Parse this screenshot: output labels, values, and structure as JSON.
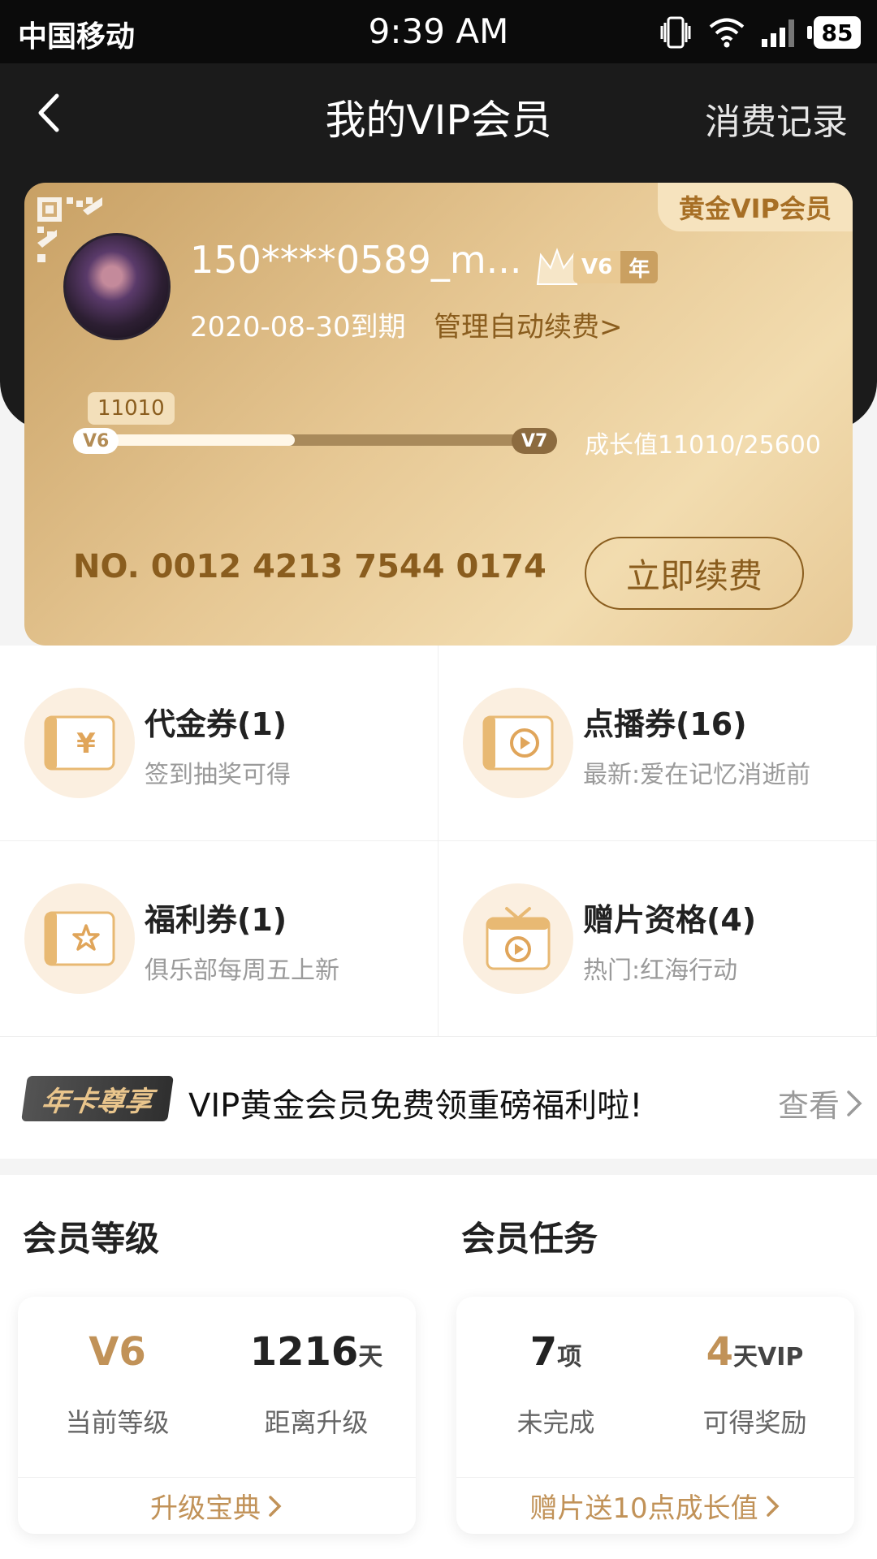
{
  "status_bar": {
    "carrier": "中国移动",
    "time": "9:39 AM",
    "battery": "85"
  },
  "nav": {
    "title": "我的VIP会员",
    "right_link": "消费记录"
  },
  "vip_card": {
    "tag": "黄金VIP会员",
    "username": "150****0589_m...",
    "level_badge": "V6",
    "level_badge_year": "年",
    "expire": "2020-08-30到期",
    "manage_renew": "管理自动续费>",
    "growth_value_bubble": "11010",
    "current_level": "V6",
    "next_level": "V7",
    "growth_text": "成长值11010/25600",
    "growth_progress": 0.43,
    "card_number": "NO. 0012 4213 7544 0174",
    "renew_button": "立即续费"
  },
  "coupons": [
    {
      "title": "代金券(1)",
      "subtitle": "签到抽奖可得",
      "icon": "yuan-ticket-icon"
    },
    {
      "title": "点播券(16)",
      "subtitle": "最新:爱在记忆消逝前",
      "icon": "play-ticket-icon"
    },
    {
      "title": "福利券(1)",
      "subtitle": "俱乐部每周五上新",
      "icon": "star-ticket-icon"
    },
    {
      "title": "赠片资格(4)",
      "subtitle": "热门:红海行动",
      "icon": "gift-video-icon"
    }
  ],
  "promo": {
    "badge": "年卡尊享",
    "text": "VIP黄金会员免费领重磅福利啦!",
    "link": "查看"
  },
  "member_level": {
    "title": "会员等级",
    "stat1_value": "V6",
    "stat1_label": "当前等级",
    "stat2_value": "1216",
    "stat2_unit": "天",
    "stat2_label": "距离升级",
    "link": "升级宝典"
  },
  "member_tasks": {
    "title": "会员任务",
    "stat1_value": "7",
    "stat1_unit": "项",
    "stat1_label": "未完成",
    "stat2_value": "4",
    "stat2_unit": "天VIP",
    "stat2_label": "可得奖励",
    "link": "赠片送10点成长值"
  },
  "colors": {
    "gold_text": "#c19258",
    "brown_text": "#8a5d1e",
    "nav_bg": "#1b1b1b"
  }
}
